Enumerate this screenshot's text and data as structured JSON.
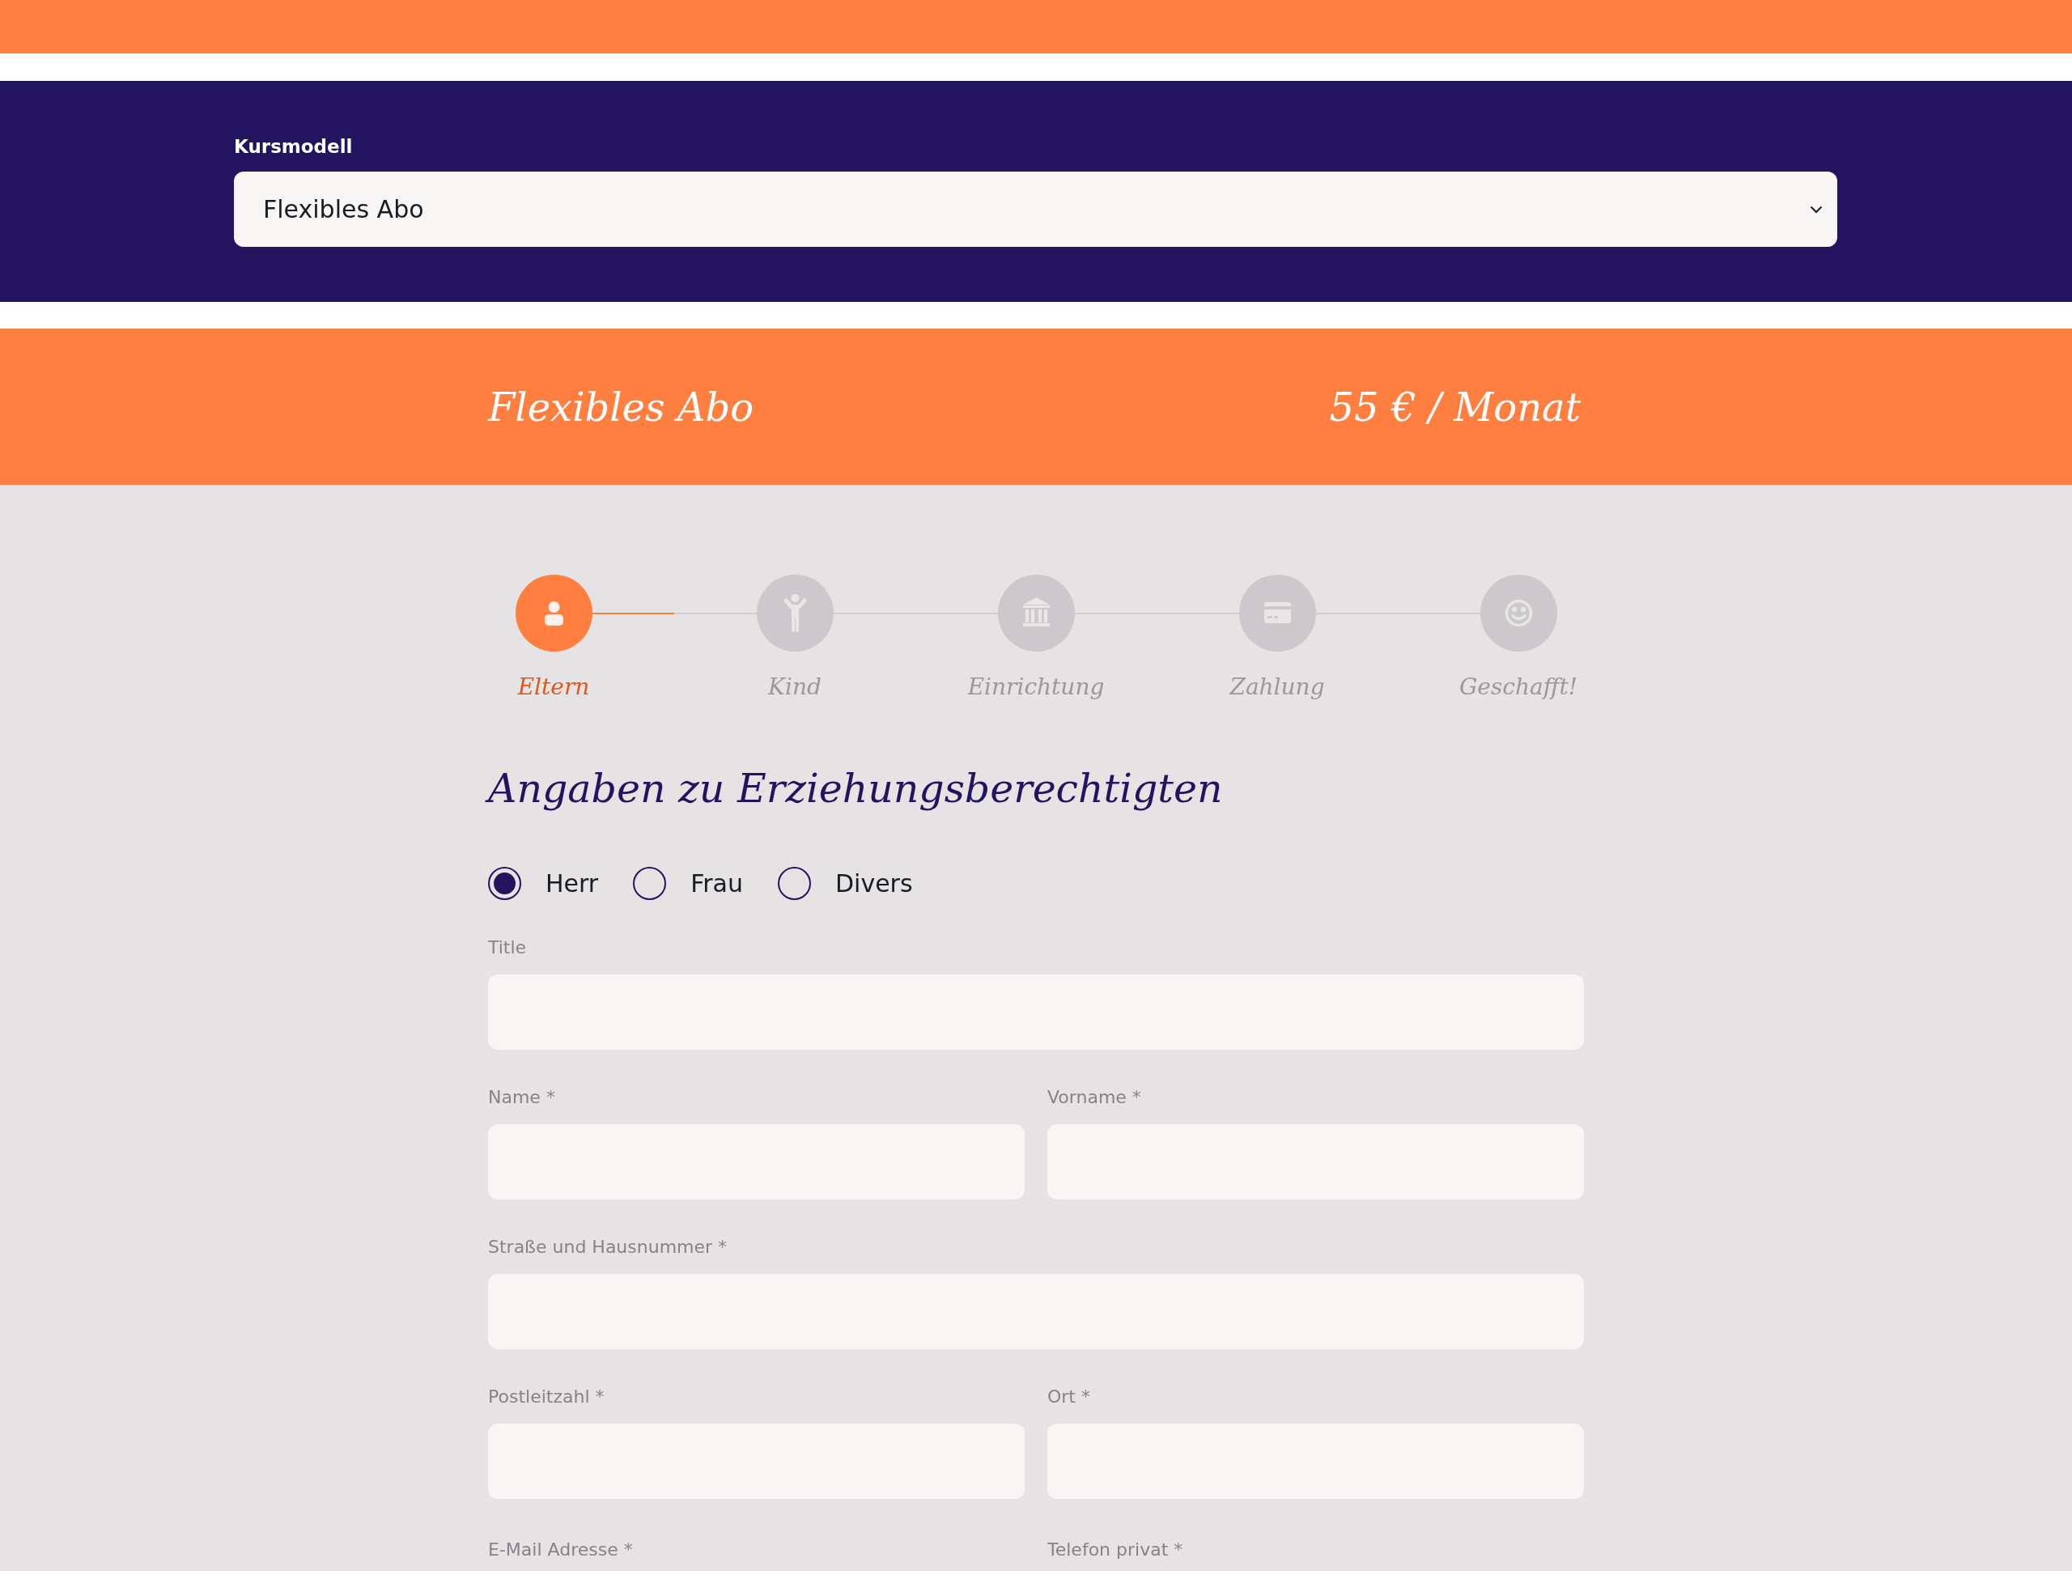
{
  "course_select": {
    "label": "Kursmodell",
    "value": "Flexibles Abo"
  },
  "price_banner": {
    "title": "Flexibles Abo",
    "price": "55 € / Monat"
  },
  "steps": [
    {
      "label": "Eltern",
      "selected": true
    },
    {
      "label": "Kind",
      "selected": false
    },
    {
      "label": "Einrichtung",
      "selected": false
    },
    {
      "label": "Zahlung",
      "selected": false
    },
    {
      "label": "Geschafft!",
      "selected": false
    }
  ],
  "form": {
    "heading": "Angaben zu Erziehungsberechtigten",
    "salutation": [
      {
        "label": "Herr",
        "selected": true
      },
      {
        "label": "Frau",
        "selected": false
      },
      {
        "label": "Divers",
        "selected": false
      }
    ],
    "rows": [
      {
        "fields": [
          {
            "label": "Title"
          }
        ]
      },
      {
        "fields": [
          {
            "label": "Name *"
          },
          {
            "label": "Vorname *"
          }
        ]
      },
      {
        "fields": [
          {
            "label": "Straße und Hausnummer *"
          }
        ]
      },
      {
        "fields": [
          {
            "label": "Postleitzahl *"
          },
          {
            "label": "Ort *"
          }
        ]
      }
    ],
    "partial_row_labels": [
      "E-Mail Adresse *",
      "Telefon privat *"
    ]
  }
}
